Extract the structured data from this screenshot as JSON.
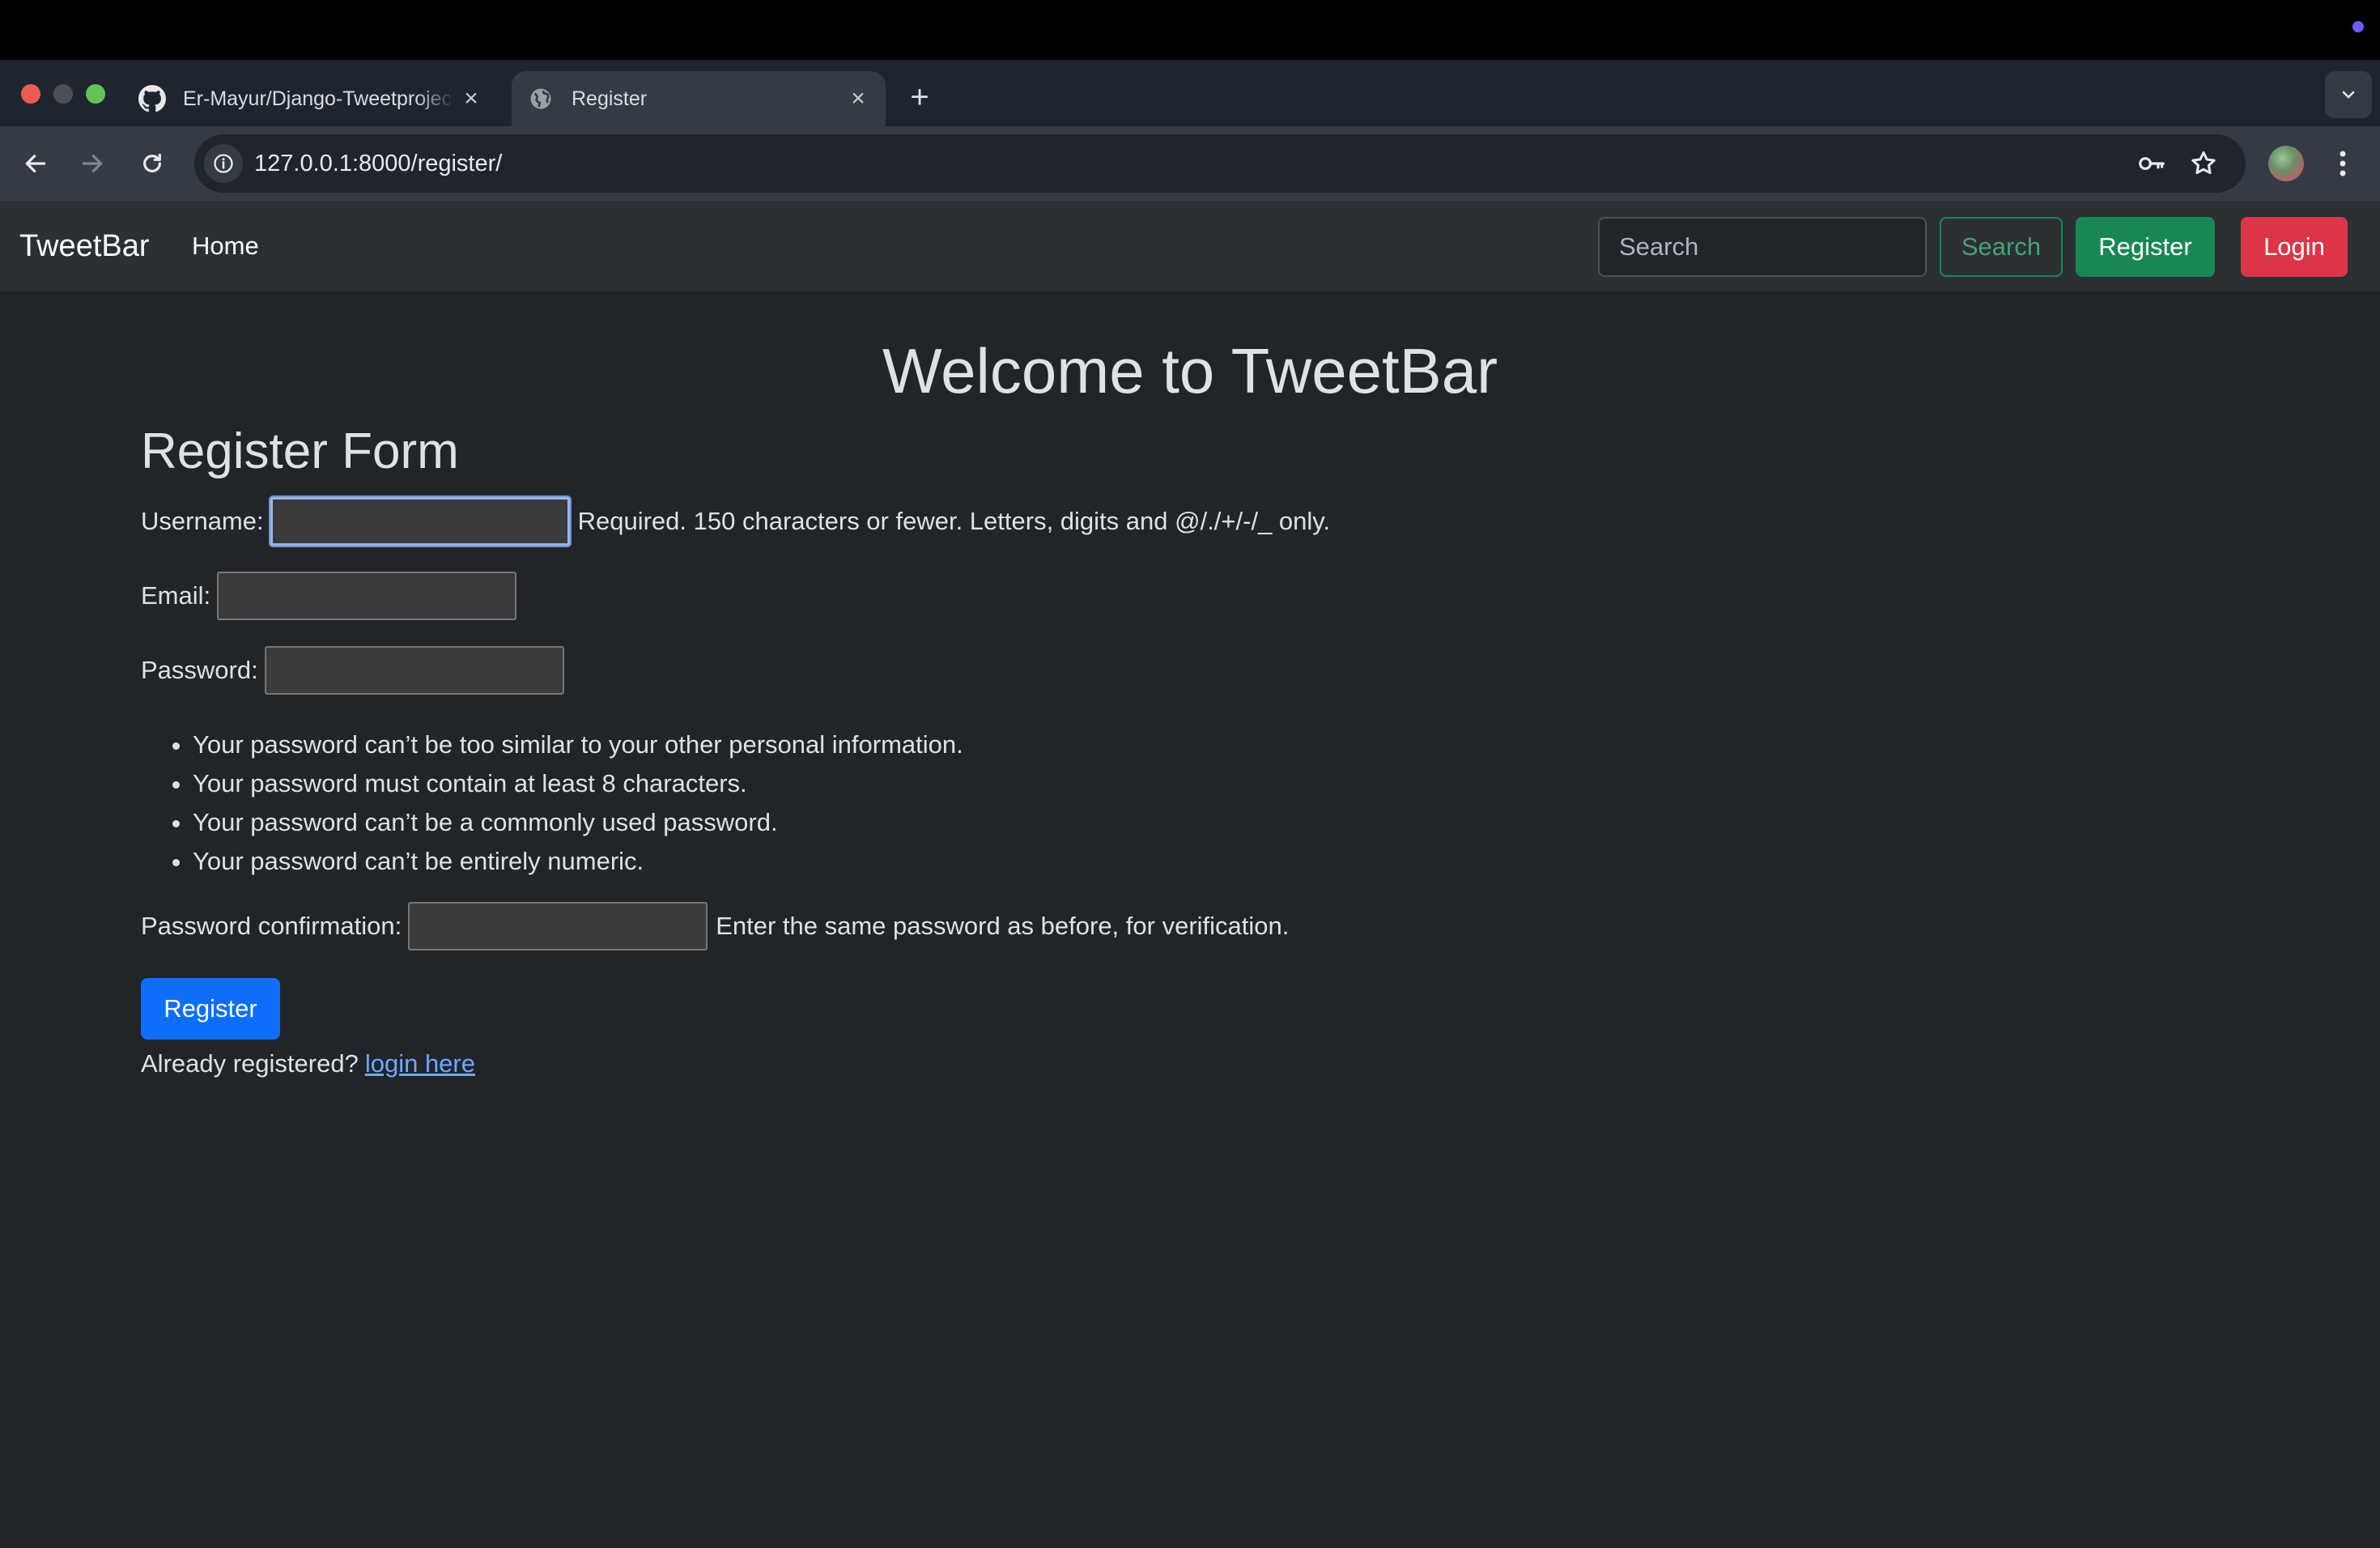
{
  "browser": {
    "tabs": [
      {
        "title": "Er-Mayur/Django-Tweetproject",
        "active": false,
        "icon": "github-icon"
      },
      {
        "title": "Register",
        "active": true,
        "icon": "globe-icon"
      }
    ],
    "url": "127.0.0.1:8000/register/"
  },
  "navbar": {
    "brand": "TweetBar",
    "home": "Home",
    "search_placeholder": "Search",
    "search_button": "Search",
    "register_button": "Register",
    "login_button": "Login"
  },
  "main": {
    "heading": "Welcome to TweetBar",
    "form_title": "Register Form",
    "username": {
      "label": "Username:",
      "value": "",
      "help": "Required. 150 characters or fewer. Letters, digits and @/./+/-/_ only."
    },
    "email": {
      "label": "Email:",
      "value": ""
    },
    "password": {
      "label": "Password:",
      "value": ""
    },
    "password_rules": [
      "Your password can’t be too similar to your other personal information.",
      "Your password must contain at least 8 characters.",
      "Your password can’t be a commonly used password.",
      "Your password can’t be entirely numeric."
    ],
    "password_confirmation": {
      "label": "Password confirmation:",
      "value": "",
      "help": "Enter the same password as before, for verification."
    },
    "submit": "Register",
    "already_text": "Already registered?",
    "login_link": "login here"
  },
  "colors": {
    "page_bg": "#212529",
    "navbar_bg": "#2b3035",
    "success": "#198754",
    "danger": "#dc3545",
    "primary": "#0d6efd",
    "link": "#6ea8fe"
  }
}
